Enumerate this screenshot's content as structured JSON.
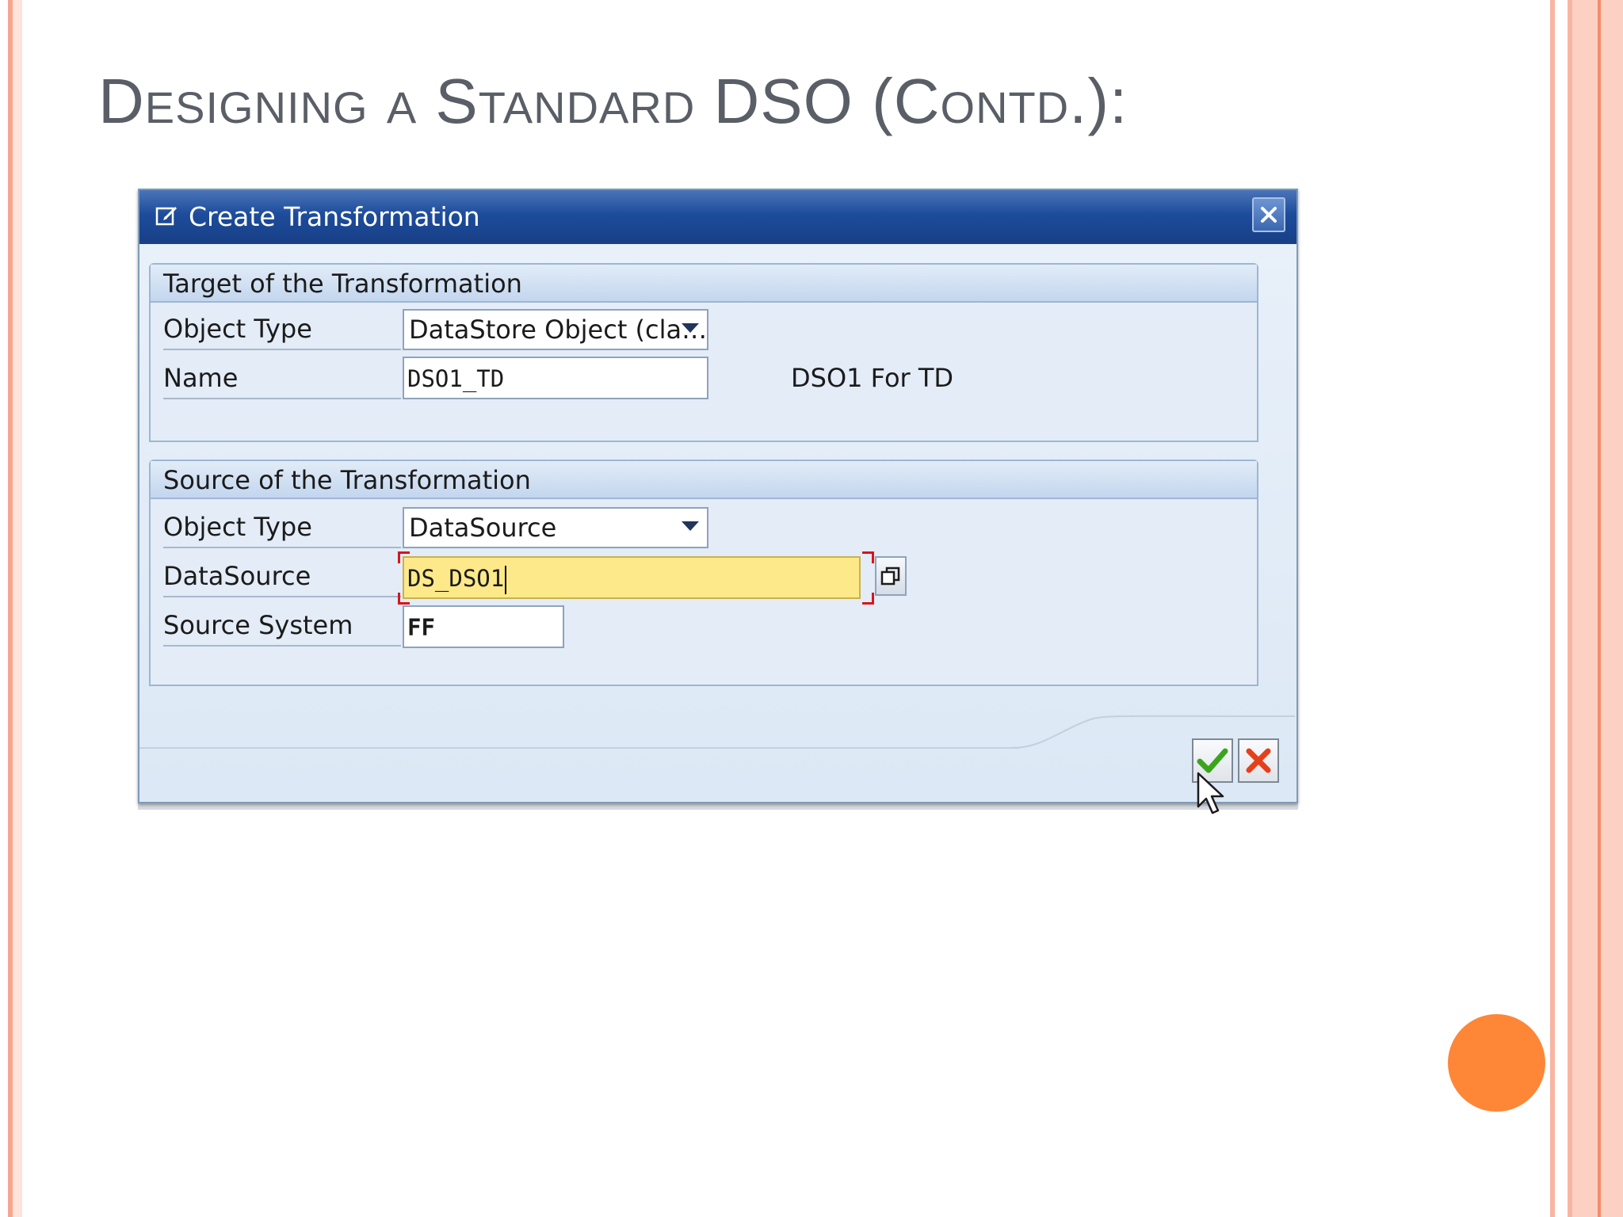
{
  "slide": {
    "title": "Designing a Standard DSO (Contd.):",
    "accent_color": "#fe8637",
    "stripe_color": "#f7b5a2"
  },
  "dialog": {
    "title": "Create Transformation",
    "title_icon": "create-transformation-icon",
    "close_icon": "close-icon",
    "target_group": {
      "header": "Target of the Transformation",
      "object_type_label": "Object Type",
      "object_type_value": "DataStore Object (cla…",
      "name_label": "Name",
      "name_value": "DSO1_TD",
      "name_description": "DSO1 For TD"
    },
    "source_group": {
      "header": "Source of the Transformation",
      "object_type_label": "Object Type",
      "object_type_value": "DataSource",
      "datasource_label": "DataSource",
      "datasource_value": "DS_DSO1",
      "source_system_label": "Source System",
      "source_system_value": "FF"
    },
    "buttons": {
      "ok_icon": "checkmark-icon",
      "cancel_icon": "cancel-x-icon"
    },
    "colors": {
      "titlebar": "#1d4c9b",
      "active_field": "#fde98a",
      "ok_green": "#3aa51c",
      "cancel_red": "#e5401a"
    }
  }
}
